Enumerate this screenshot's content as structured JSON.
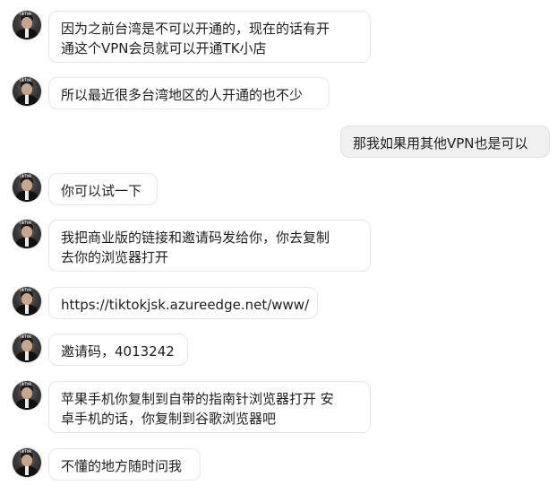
{
  "avatar": {
    "logo_text": "♪ TikTok",
    "icon": "user-avatar-icon"
  },
  "messages": [
    {
      "direction": "received",
      "text": "因为之前台湾是不可以开通的，现在的话有开\n通这个VPN会员就可以开通TK小店"
    },
    {
      "direction": "received",
      "text": "所以最近很多台湾地区的人开通的也不少"
    },
    {
      "direction": "sent",
      "text": "那我如果用其他VPN也是可以"
    },
    {
      "direction": "received",
      "text": "你可以试一下"
    },
    {
      "direction": "received",
      "text": "我把商业版的链接和邀请码发给你，你去复制\n去你的浏览器打开"
    },
    {
      "direction": "received",
      "text": "https://tiktokjsk.azureedge.net/www/"
    },
    {
      "direction": "received",
      "text": "邀请码，4013242"
    },
    {
      "direction": "received",
      "text": "苹果手机你复制到自带的指南针浏览器打开 安\n卓手机的话，你复制到谷歌浏览器吧"
    },
    {
      "direction": "received",
      "text": "不懂的地方随时问我"
    }
  ]
}
